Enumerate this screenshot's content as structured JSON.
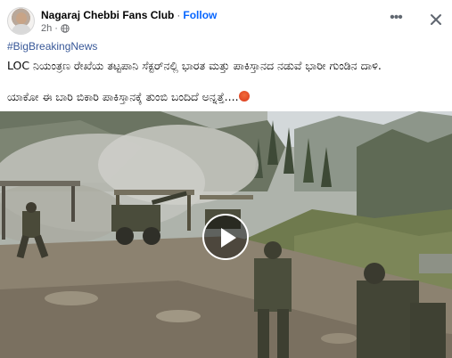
{
  "post": {
    "page_name": "Nagaraj Chebbi Fans Club",
    "separator": "·",
    "follow_label": "Follow",
    "time": "2h",
    "time_separator": "·",
    "hashtag": "#BigBreakingNews",
    "text_line1": "LOC ನಿಯಂತ್ರಣ ರೇಖೆಯ ತಟ್ಟಪಾನಿ ಸೆಕ್ಟರ್‌ನಲ್ಲಿ ಭಾರತ ಮತ್ತು ಪಾಕಿಸ್ತಾನದ ನಡುವೆ ಭಾರೀ ಗುಂಡಿನ ದಾಳಿ.",
    "text_line2": "ಯಾಕೋ ಈ ಬಾರಿ ಬಿಕಾರಿ ಪಾಕಿಸ್ತಾನಕ್ಕೆ ತುಂಬಿ ಬಂದಿದೆ ಅನ್ನತ್ತೆ....",
    "icons": {
      "more": "more-horizontal-icon",
      "close": "close-icon",
      "audience": "globe-icon",
      "emoji": "angry-face-emoji",
      "play": "play-icon"
    }
  }
}
